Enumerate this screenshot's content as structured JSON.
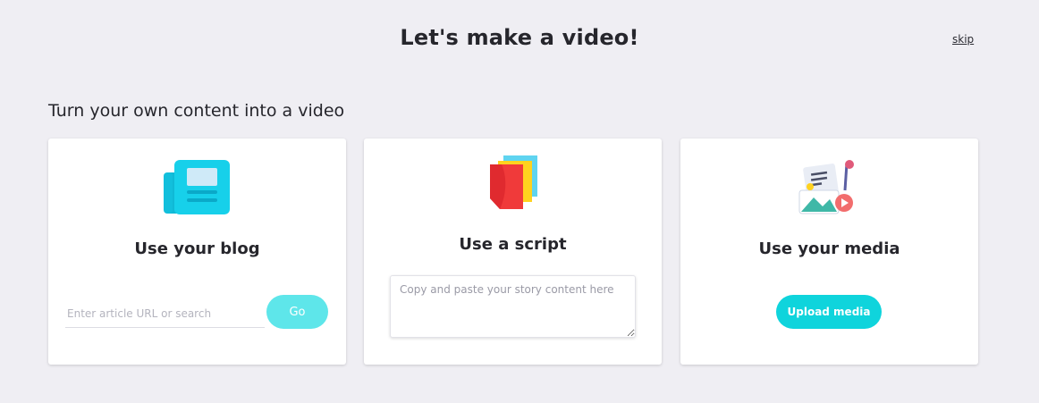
{
  "header": {
    "title": "Let's make a video!",
    "skip_label": "skip"
  },
  "section": {
    "title": "Turn your own content into a video"
  },
  "cards": {
    "blog": {
      "icon": "newspaper-icon",
      "title": "Use your blog",
      "input_placeholder": "Enter article URL or search",
      "input_value": "",
      "button_label": "Go"
    },
    "script": {
      "icon": "script-pages-icon",
      "title": "Use a script",
      "textarea_placeholder": "Copy and paste your story content here",
      "textarea_value": ""
    },
    "media": {
      "icon": "media-collage-icon",
      "title": "Use your media",
      "button_label": "Upload media"
    }
  },
  "colors": {
    "background": "#efeef3",
    "card": "#ffffff",
    "accent": "#0fd4dc",
    "accent_disabled": "#5ee6ea"
  }
}
